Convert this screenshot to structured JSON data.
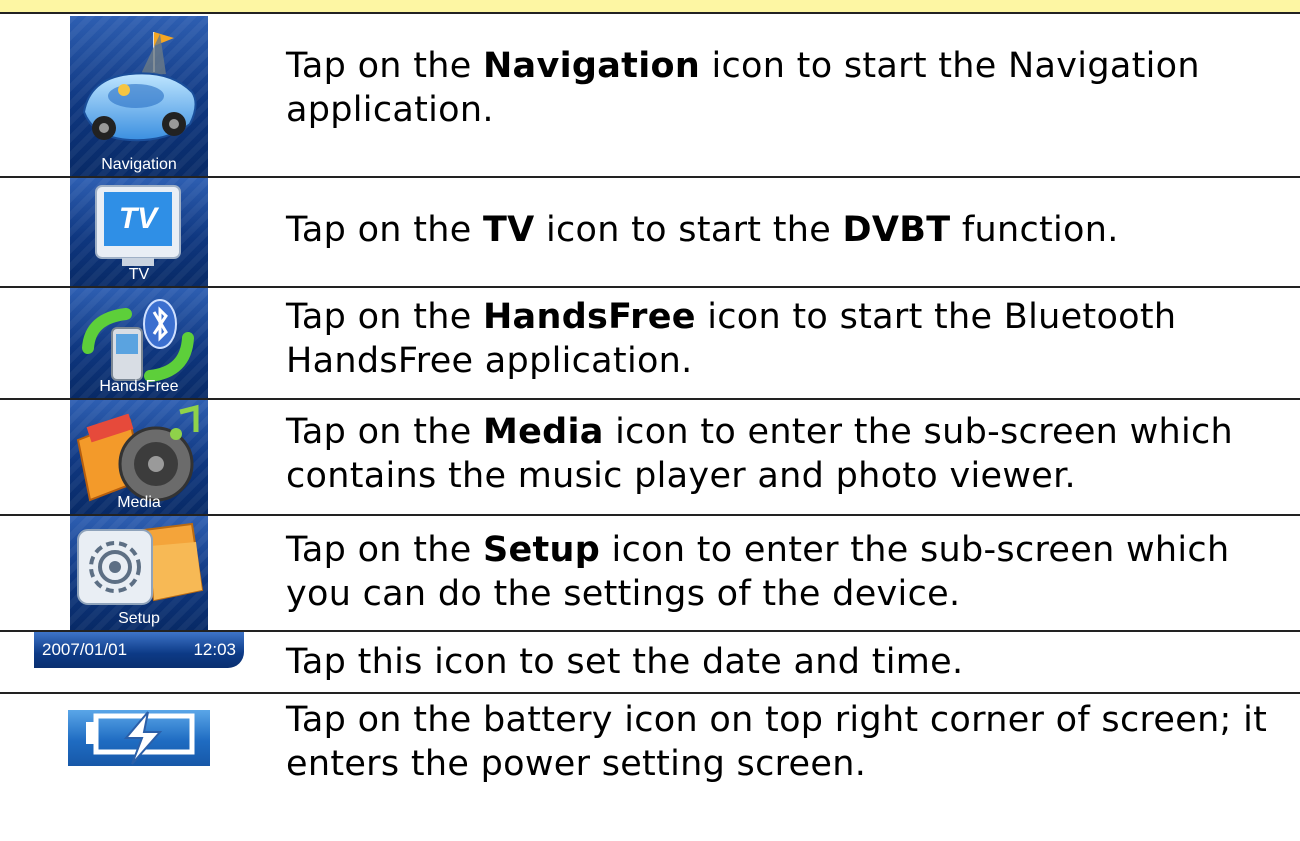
{
  "rows": [
    {
      "icon_label": "Navigation",
      "pre": "Tap on the ",
      "bold": "Navigation",
      "post": " icon to start the Navigation application."
    },
    {
      "icon_label": "TV",
      "pre": "Tap on the ",
      "bold": "TV",
      "mid": " icon to start the ",
      "bold2": "DVBT",
      "post": " function."
    },
    {
      "icon_label": "HandsFree",
      "pre": "Tap on the ",
      "bold": "HandsFree",
      "post": " icon to start the Bluetooth HandsFree application."
    },
    {
      "icon_label": "Media",
      "pre": "Tap on the ",
      "bold": "Media",
      "post": " icon to enter the sub-screen which contains the music player and photo viewer."
    },
    {
      "icon_label": "Setup",
      "pre": "Tap on the ",
      "bold": "Setup",
      "post": " icon to enter the sub-screen which you can do the settings of the device."
    }
  ],
  "datetime_row": {
    "date": "2007/01/01",
    "time": "12:03",
    "text": "Tap this icon to set the date and time."
  },
  "battery_row": {
    "text": "Tap on the battery icon on top right corner of screen; it enters the power setting screen."
  },
  "colors": {
    "header_band": "#fdf6a3",
    "tile_blue": "#0f3780"
  }
}
